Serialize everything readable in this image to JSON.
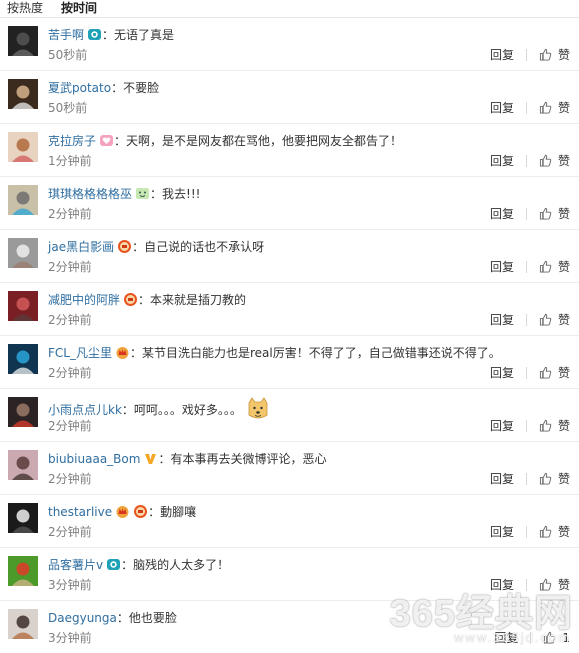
{
  "tabs": {
    "hot": "按热度",
    "time": "按时间"
  },
  "comments": [
    {
      "user": "苦手啊",
      "badges": [
        "camera-badge"
      ],
      "text": "无语了真是",
      "time": "50秒前",
      "reply": "回复",
      "like": "赞",
      "avatar_color": "#222222"
    },
    {
      "user": "夏武potato",
      "badges": [],
      "text": "不要脸",
      "time": "50秒前",
      "reply": "回复",
      "like": "赞",
      "avatar_color": "#3b2a1e"
    },
    {
      "user": "克拉房子",
      "badges": [
        "heart-badge"
      ],
      "text": "天啊，是不是网友都在骂他，他要把网友全都告了！",
      "time": "1分钟前",
      "reply": "回复",
      "like": "赞",
      "avatar_color": "#e8d2c0"
    },
    {
      "user": "琪琪格格格格巫",
      "badges": [
        "face-badge"
      ],
      "text": "我去!!!",
      "time": "2分钟前",
      "reply": "回复",
      "like": "赞",
      "avatar_color": "#c9c0a8"
    },
    {
      "user": "jae黑白影画",
      "badges": [
        "red-badge"
      ],
      "text": "自己说的话也不承认呀",
      "time": "2分钟前",
      "reply": "回复",
      "like": "赞",
      "avatar_color": "#9a9a9a"
    },
    {
      "user": "减肥中的阿胖",
      "badges": [
        "red-badge"
      ],
      "text": "本来就是插刀教的",
      "time": "2分钟前",
      "reply": "回复",
      "like": "赞",
      "avatar_color": "#7a1f24"
    },
    {
      "user": "FCL_凡尘里",
      "badges": [
        "crown-badge"
      ],
      "text": "某节目洗白能力也是real厉害！不得了了，自己做错事还说不得了。",
      "time": "2分钟前",
      "reply": "回复",
      "like": "赞",
      "avatar_color": "#0f3550"
    },
    {
      "user": "小雨点点儿kk",
      "badges": [],
      "text": "呵呵。。。戏好多。。。",
      "time": "2分钟前",
      "reply": "回复",
      "like": "赞",
      "avatar_color": "#2c2424",
      "sticker": "doge-sticker"
    },
    {
      "user": "biubiuaaa_Bom",
      "badges": [
        "v-badge"
      ],
      "text": "有本事再去关微博评论，恶心",
      "time": "2分钟前",
      "reply": "回复",
      "like": "赞",
      "avatar_color": "#caa9b0"
    },
    {
      "user": "thestarlive",
      "badges": [
        "crown-badge",
        "red-badge"
      ],
      "text": "動腳嚷",
      "time": "2分钟前",
      "reply": "回复",
      "like": "赞",
      "avatar_color": "#1a1a1a"
    },
    {
      "user": "品客薯片v",
      "badges": [
        "camera-badge"
      ],
      "text": "脑残的人太多了！",
      "time": "3分钟前",
      "reply": "回复",
      "like": "赞",
      "avatar_color": "#4c9a2a"
    },
    {
      "user": "Daegyunga",
      "badges": [],
      "text": "他也要脸",
      "time": "3分钟前",
      "reply": "回复",
      "like": "1",
      "avatar_color": "#d9d2cc"
    }
  ],
  "sep": "：",
  "watermark": {
    "main": "365经典网",
    "sub": "www.365jd.com"
  }
}
